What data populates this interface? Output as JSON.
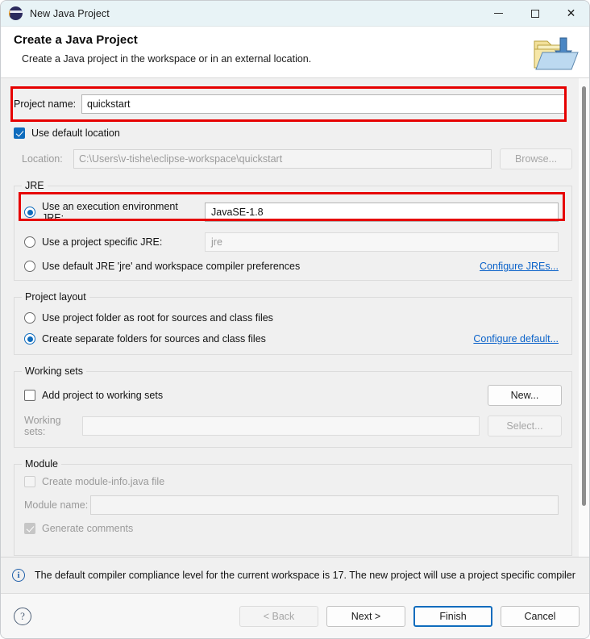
{
  "window": {
    "title": "New Java Project",
    "logo_icon": "eclipse-logo-icon",
    "minimize_label": "Minimize",
    "maximize_label": "Maximize",
    "close_label": "Close",
    "close_glyph": "✕"
  },
  "header": {
    "title": "Create a Java Project",
    "subtitle": "Create a Java project in the workspace or in an external location.",
    "icon": "new-java-project-folder-icon"
  },
  "project_name": {
    "label": "Project name:",
    "value": "quickstart",
    "placeholder": ""
  },
  "location": {
    "use_default_label": "Use default location",
    "use_default_checked": true,
    "label": "Location:",
    "value": "C:\\Users\\v-tishe\\eclipse-workspace\\quickstart",
    "browse_label": "Browse..."
  },
  "jre": {
    "group_title": "JRE",
    "options": [
      {
        "label": "Use an execution environment JRE:",
        "selected": true
      },
      {
        "label": "Use a project specific JRE:",
        "selected": false
      },
      {
        "label": "Use default JRE 'jre' and workspace compiler preferences",
        "selected": false
      }
    ],
    "execution_env_value": "JavaSE-1.8",
    "project_jre_value": "jre",
    "configure_link": "Configure JREs..."
  },
  "project_layout": {
    "group_title": "Project layout",
    "options": [
      {
        "label": "Use project folder as root for sources and class files",
        "selected": false
      },
      {
        "label": "Create separate folders for sources and class files",
        "selected": true
      }
    ],
    "configure_link": "Configure default..."
  },
  "working_sets": {
    "group_title": "Working sets",
    "add_label": "Add project to working sets",
    "add_checked": false,
    "new_label": "New...",
    "sets_label": "Working sets:",
    "sets_value": "",
    "select_label": "Select..."
  },
  "module": {
    "group_title": "Module",
    "create_module_info_label": "Create module-info.java file",
    "create_module_info_checked": false,
    "module_name_label": "Module name:",
    "module_name_value": "",
    "generate_comments_label": "Generate comments",
    "generate_comments_checked": true
  },
  "info": {
    "icon": "info-icon",
    "message": "The default compiler compliance level for the current workspace is 17. The new project will use a project specific compiler"
  },
  "footer": {
    "help_label": "?",
    "back_label": "< Back",
    "next_label": "Next >",
    "finish_label": "Finish",
    "cancel_label": "Cancel"
  },
  "annotations": {
    "accent_color": "#e60000",
    "boxes": [
      "project-name-row",
      "execution-environment-row"
    ]
  }
}
